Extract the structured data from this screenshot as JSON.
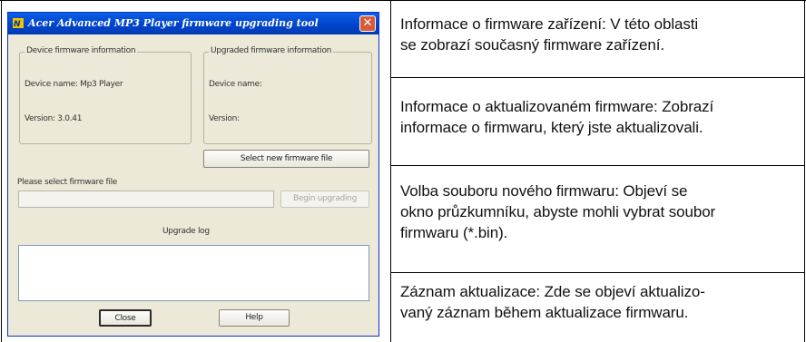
{
  "dialog": {
    "title": "Acer Advanced MP3 Player firmware upgrading tool",
    "device_group_title": "Device firmware information",
    "device_name": "Device name: Mp3 Player",
    "device_version": "Version: 3.0.41",
    "upgraded_group_title": "Upgraded firmware information",
    "upgraded_name": "Device name:",
    "upgraded_version": "Version:",
    "select_button": "Select new firmware file",
    "please_select": "Please select firmware file",
    "begin_button": "Begin upgrading",
    "upgrade_log_label": "Upgrade log",
    "close_button": "Close",
    "help_button": "Help"
  },
  "descriptions": [
    {
      "line1": "Informace o firmware zařízení: V této oblasti",
      "line2": "se zobrazí současný firmware zařízení.",
      "line3": ""
    },
    {
      "line1": "Informace o aktualizovaném firmware: Zobrazí",
      "line2": "informace o firmwaru, který jste aktualizovali.",
      "line3": ""
    },
    {
      "line1": "Volba souboru nového firmwaru: Objeví se",
      "line2": "okno průzkumníku, abyste mohli vybrat soubor",
      "line3": "firmwaru (*.bin)."
    },
    {
      "line1": "Záznam aktualizace: Zde se objeví aktualizo-",
      "line2": "vaný záznam během aktualizace firmwaru.",
      "line3": ""
    }
  ]
}
